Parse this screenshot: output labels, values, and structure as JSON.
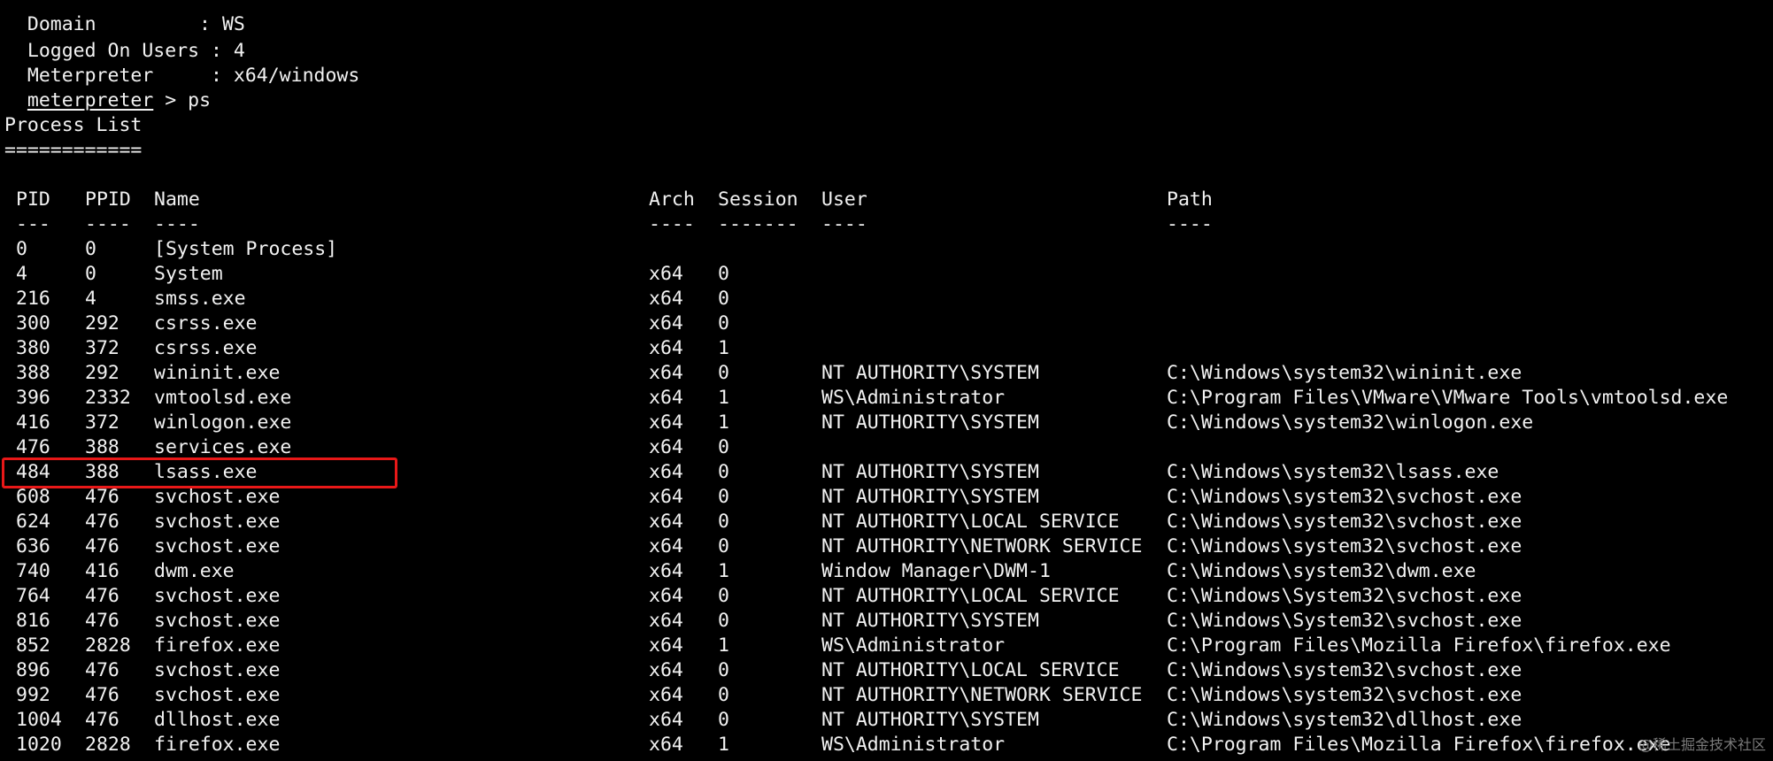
{
  "session_info": [
    {
      "label": "Domain        ",
      "sep": " : ",
      "value": "WS"
    },
    {
      "label": "Logged On Users",
      "sep": " : ",
      "value": "4"
    },
    {
      "label": "Meterpreter    ",
      "sep": " : ",
      "value": "x64/windows"
    }
  ],
  "prompt": {
    "name": "meterpreter",
    "symbol": " > ",
    "command": "ps"
  },
  "section_title": "Process List",
  "section_rule": "============",
  "columns": {
    "pid": "PID",
    "ppid": "PPID",
    "name": "Name",
    "arch": "Arch",
    "session": "Session",
    "user": "User",
    "path": "Path"
  },
  "dashes": {
    "pid": "---",
    "ppid": "----",
    "name": "----",
    "arch": "----",
    "session": "-------",
    "user": "----",
    "path": "----"
  },
  "processes": [
    {
      "pid": "0",
      "ppid": "0",
      "name": "[System Process]",
      "arch": "",
      "session": "",
      "user": "",
      "path": ""
    },
    {
      "pid": "4",
      "ppid": "0",
      "name": "System",
      "arch": "x64",
      "session": "0",
      "user": "",
      "path": ""
    },
    {
      "pid": "216",
      "ppid": "4",
      "name": "smss.exe",
      "arch": "x64",
      "session": "0",
      "user": "",
      "path": ""
    },
    {
      "pid": "300",
      "ppid": "292",
      "name": "csrss.exe",
      "arch": "x64",
      "session": "0",
      "user": "",
      "path": ""
    },
    {
      "pid": "380",
      "ppid": "372",
      "name": "csrss.exe",
      "arch": "x64",
      "session": "1",
      "user": "",
      "path": ""
    },
    {
      "pid": "388",
      "ppid": "292",
      "name": "wininit.exe",
      "arch": "x64",
      "session": "0",
      "user": "NT AUTHORITY\\SYSTEM",
      "path": "C:\\Windows\\system32\\wininit.exe"
    },
    {
      "pid": "396",
      "ppid": "2332",
      "name": "vmtoolsd.exe",
      "arch": "x64",
      "session": "1",
      "user": "WS\\Administrator",
      "path": "C:\\Program Files\\VMware\\VMware Tools\\vmtoolsd.exe"
    },
    {
      "pid": "416",
      "ppid": "372",
      "name": "winlogon.exe",
      "arch": "x64",
      "session": "1",
      "user": "NT AUTHORITY\\SYSTEM",
      "path": "C:\\Windows\\system32\\winlogon.exe"
    },
    {
      "pid": "476",
      "ppid": "388",
      "name": "services.exe",
      "arch": "x64",
      "session": "0",
      "user": "",
      "path": ""
    },
    {
      "pid": "484",
      "ppid": "388",
      "name": "lsass.exe",
      "arch": "x64",
      "session": "0",
      "user": "NT AUTHORITY\\SYSTEM",
      "path": "C:\\Windows\\system32\\lsass.exe"
    },
    {
      "pid": "608",
      "ppid": "476",
      "name": "svchost.exe",
      "arch": "x64",
      "session": "0",
      "user": "NT AUTHORITY\\SYSTEM",
      "path": "C:\\Windows\\system32\\svchost.exe"
    },
    {
      "pid": "624",
      "ppid": "476",
      "name": "svchost.exe",
      "arch": "x64",
      "session": "0",
      "user": "NT AUTHORITY\\LOCAL SERVICE",
      "path": "C:\\Windows\\system32\\svchost.exe"
    },
    {
      "pid": "636",
      "ppid": "476",
      "name": "svchost.exe",
      "arch": "x64",
      "session": "0",
      "user": "NT AUTHORITY\\NETWORK SERVICE",
      "path": "C:\\Windows\\system32\\svchost.exe"
    },
    {
      "pid": "740",
      "ppid": "416",
      "name": "dwm.exe",
      "arch": "x64",
      "session": "1",
      "user": "Window Manager\\DWM-1",
      "path": "C:\\Windows\\system32\\dwm.exe"
    },
    {
      "pid": "764",
      "ppid": "476",
      "name": "svchost.exe",
      "arch": "x64",
      "session": "0",
      "user": "NT AUTHORITY\\LOCAL SERVICE",
      "path": "C:\\Windows\\System32\\svchost.exe"
    },
    {
      "pid": "816",
      "ppid": "476",
      "name": "svchost.exe",
      "arch": "x64",
      "session": "0",
      "user": "NT AUTHORITY\\SYSTEM",
      "path": "C:\\Windows\\System32\\svchost.exe"
    },
    {
      "pid": "852",
      "ppid": "2828",
      "name": "firefox.exe",
      "arch": "x64",
      "session": "1",
      "user": "WS\\Administrator",
      "path": "C:\\Program Files\\Mozilla Firefox\\firefox.exe"
    },
    {
      "pid": "896",
      "ppid": "476",
      "name": "svchost.exe",
      "arch": "x64",
      "session": "0",
      "user": "NT AUTHORITY\\LOCAL SERVICE",
      "path": "C:\\Windows\\system32\\svchost.exe"
    },
    {
      "pid": "992",
      "ppid": "476",
      "name": "svchost.exe",
      "arch": "x64",
      "session": "0",
      "user": "NT AUTHORITY\\NETWORK SERVICE",
      "path": "C:\\Windows\\system32\\svchost.exe"
    },
    {
      "pid": "1004",
      "ppid": "476",
      "name": "dllhost.exe",
      "arch": "x64",
      "session": "0",
      "user": "NT AUTHORITY\\SYSTEM",
      "path": "C:\\Windows\\system32\\dllhost.exe"
    },
    {
      "pid": "1020",
      "ppid": "2828",
      "name": "firefox.exe",
      "arch": "x64",
      "session": "1",
      "user": "WS\\Administrator",
      "path": "C:\\Program Files\\Mozilla Firefox\\firefox.exe"
    }
  ],
  "highlighted_pid": "484",
  "highlight_color": "#e81818",
  "watermark": "@稀土掘金技术社区"
}
